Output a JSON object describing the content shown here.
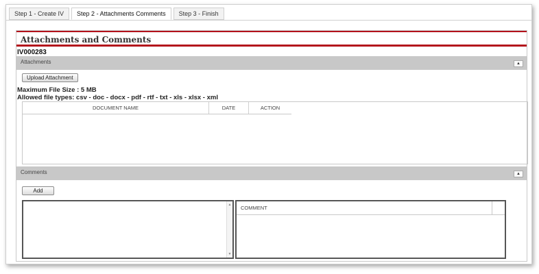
{
  "tabs": [
    {
      "label": "Step 1 - Create IV",
      "active": false
    },
    {
      "label": "Step 2 - Attachments Comments",
      "active": true
    },
    {
      "label": "Step 3 - Finish",
      "active": false
    }
  ],
  "panel": {
    "title": "Attachments and Comments",
    "record_id": "IV000283"
  },
  "attachments": {
    "section_label": "Attachments",
    "upload_button": "Upload Attachment",
    "max_size_text": "Maximum File Size : 5 MB",
    "allowed_types_text": "Allowed file types: csv - doc - docx - pdf - rtf - txt - xls - xlsx - xml",
    "columns": [
      "DOCUMENT NAME",
      "DATE",
      "ACTION"
    ],
    "rows": []
  },
  "comments": {
    "section_label": "Comments",
    "add_button": "Add",
    "input_value": "",
    "columns": [
      "COMMENT"
    ],
    "rows": []
  },
  "icons": {
    "collapse": "collapse-up-icon",
    "scroll_up": "scroll-up-icon",
    "scroll_down": "scroll-down-icon"
  },
  "colors": {
    "accent_red": "#b3121b",
    "section_bar": "#c8c8c8"
  }
}
